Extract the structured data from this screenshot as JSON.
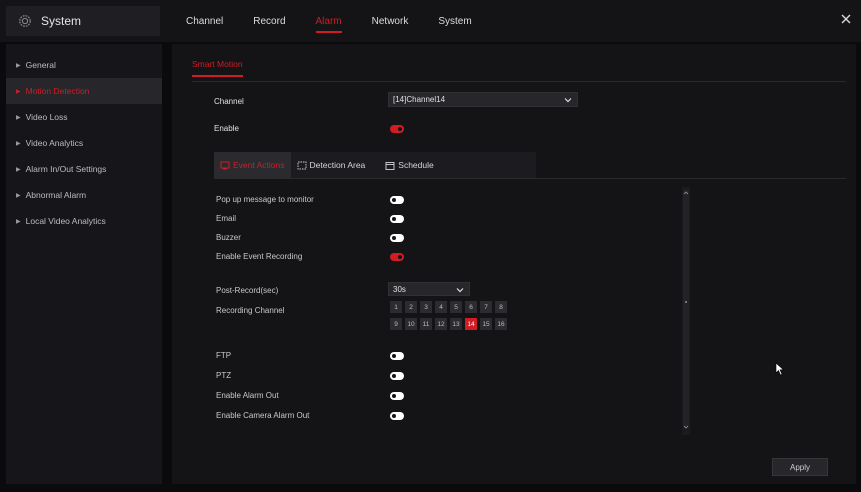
{
  "header": {
    "title": "System",
    "title_icon": "gear-icon",
    "tabs": [
      "Channel",
      "Record",
      "Alarm",
      "Network",
      "System"
    ],
    "active_tab": "Alarm",
    "close_icon": "close-icon"
  },
  "sidebar": {
    "items": [
      {
        "label": "General",
        "active": false
      },
      {
        "label": "Motion Detection",
        "active": true
      },
      {
        "label": "Video Loss",
        "active": false
      },
      {
        "label": "Video Analytics",
        "active": false
      },
      {
        "label": "Alarm In/Out Settings",
        "active": false
      },
      {
        "label": "Abnormal Alarm",
        "active": false
      },
      {
        "label": "Local Video Analytics",
        "active": false
      }
    ]
  },
  "main": {
    "subtab": "Smart Motion",
    "channel_label": "Channel",
    "channel_value": "[14]Channel14",
    "enable_label": "Enable",
    "enable_on": true,
    "inner_tabs": [
      {
        "label": "Event Actions",
        "icon": "event-actions-icon",
        "active": true
      },
      {
        "label": "Detection Area",
        "icon": "detection-area-icon",
        "active": false
      },
      {
        "label": "Schedule",
        "icon": "calendar-icon",
        "active": false
      }
    ],
    "actions": [
      {
        "label": "Pop up message to monitor",
        "on": false
      },
      {
        "label": "Email",
        "on": false
      },
      {
        "label": "Buzzer",
        "on": false
      },
      {
        "label": "Enable Event Recording",
        "on": true
      }
    ],
    "post_record_label": "Post-Record(sec)",
    "post_record_value": "30s",
    "recording_channel_label": "Recording Channel",
    "recording_channels": [
      "1",
      "2",
      "3",
      "4",
      "5",
      "6",
      "7",
      "8",
      "9",
      "10",
      "11",
      "12",
      "13",
      "14",
      "15",
      "16"
    ],
    "recording_channel_selected": "14",
    "actions2": [
      {
        "label": "FTP",
        "on": false
      },
      {
        "label": "PTZ",
        "on": false
      },
      {
        "label": "Enable Alarm Out",
        "on": false
      },
      {
        "label": "Enable Camera Alarm Out",
        "on": false
      }
    ],
    "apply_label": "Apply"
  },
  "colors": {
    "accent": "#d01c24",
    "background": "#141417",
    "sidebar": "#16161a"
  }
}
